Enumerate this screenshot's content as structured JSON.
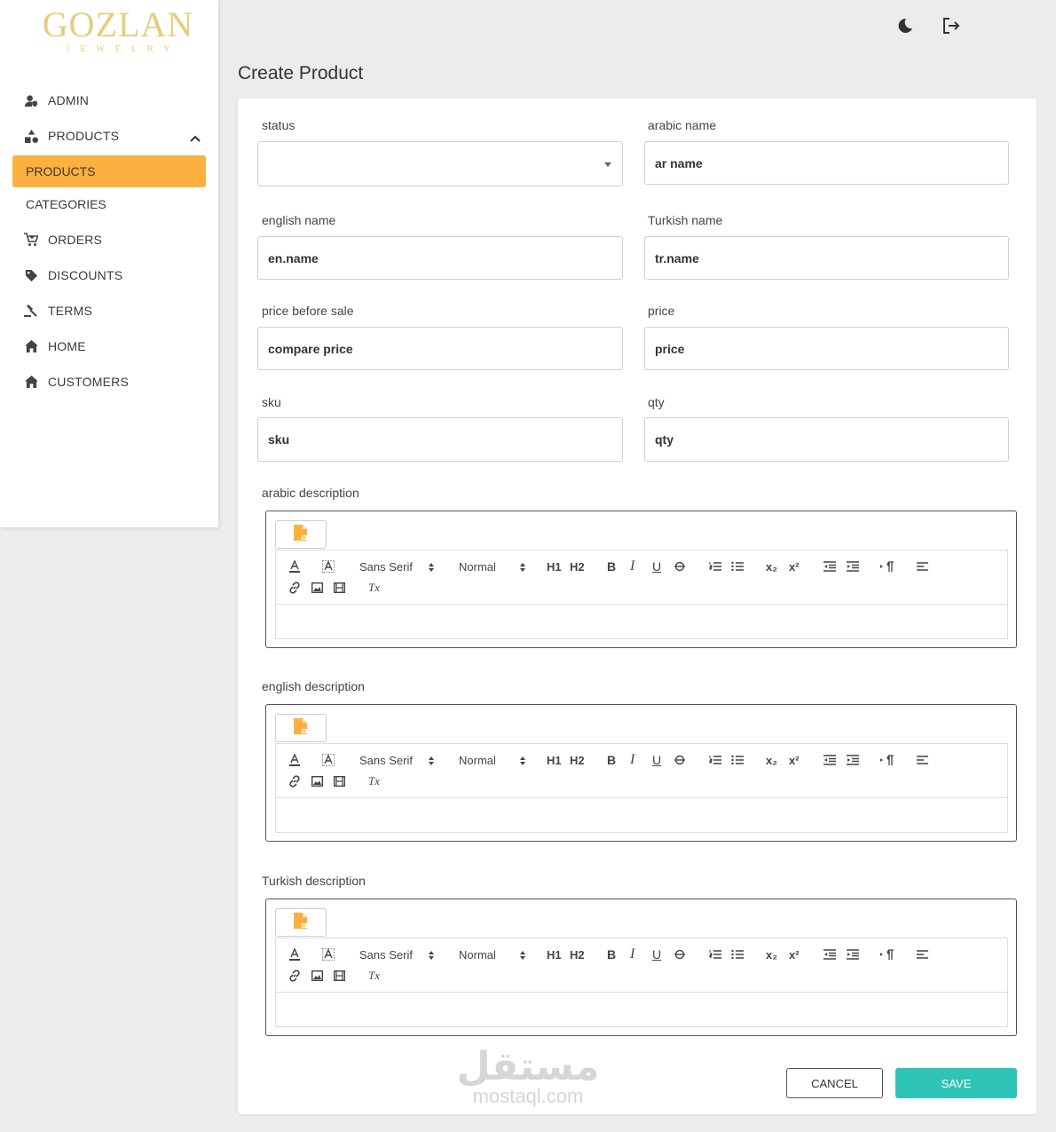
{
  "brand": {
    "name": "GOZLAN",
    "tagline": "JEWELRY",
    "color": "#e6cd7a"
  },
  "sidebar": {
    "items": [
      {
        "label": "ADMIN",
        "icon": "user-shield-icon"
      },
      {
        "label": "PRODUCTS",
        "icon": "shapes-icon",
        "expanded": true
      },
      {
        "label": "PRODUCTS",
        "sub": true,
        "active": true
      },
      {
        "label": "CATEGORIES",
        "sub": true
      },
      {
        "label": "ORDERS",
        "icon": "cart-icon"
      },
      {
        "label": "DISCOUNTS",
        "icon": "tag-icon"
      },
      {
        "label": "TERMS",
        "icon": "gavel-icon"
      },
      {
        "label": "HOME",
        "icon": "home-icon"
      },
      {
        "label": "CUSTOMERS",
        "icon": "home-icon"
      }
    ],
    "active_color": "#fcb040"
  },
  "header": {
    "theme_icon": "moon-icon",
    "logout_icon": "logout-icon"
  },
  "page": {
    "title": "Create Product"
  },
  "form": {
    "status": {
      "label": "status",
      "value": ""
    },
    "arabic_name": {
      "label": "arabic name",
      "placeholder": "ar name"
    },
    "english_name": {
      "label": "english name",
      "placeholder": "en.name"
    },
    "turkish_name": {
      "label": "Turkish name",
      "placeholder": "tr.name"
    },
    "price_before_sale": {
      "label": "price before sale",
      "placeholder": "compare price"
    },
    "price": {
      "label": "price",
      "placeholder": "price"
    },
    "sku": {
      "label": "sku",
      "placeholder": "sku"
    },
    "qty": {
      "label": "qty",
      "placeholder": "qty"
    },
    "arabic_description": {
      "label": "arabic description"
    },
    "english_description": {
      "label": "english description"
    },
    "turkish_description": {
      "label": "Turkish description"
    }
  },
  "editor": {
    "font": "Sans Serif",
    "size": "Normal",
    "h1": "H1",
    "h2": "H2",
    "bold": "B",
    "italic": "I",
    "underline": "U",
    "sub": "x₂",
    "sup": "x²",
    "clear": "Tx"
  },
  "actions": {
    "cancel": "CANCEL",
    "save": "SAVE",
    "save_color": "#2ec4b6"
  },
  "watermark": {
    "arabic": "مستقل",
    "latin": "mostaql.com"
  }
}
